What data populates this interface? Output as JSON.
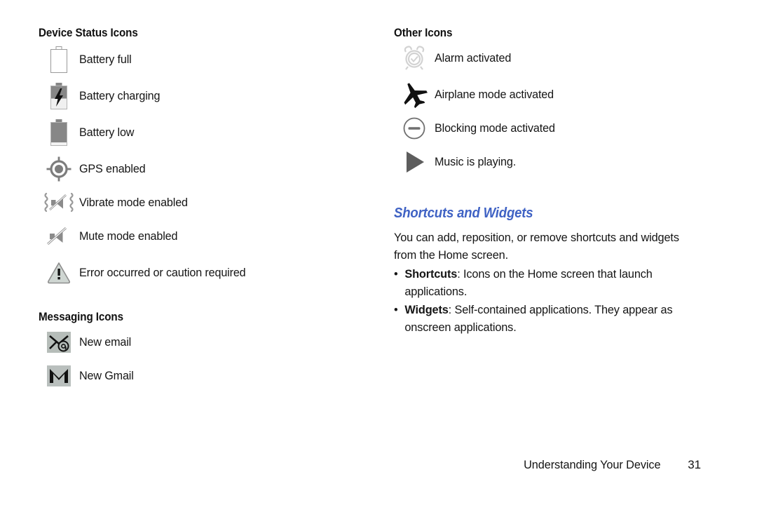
{
  "document": {
    "footer_title": "Understanding Your Device",
    "footer_page": "31"
  },
  "left_column": {
    "sections": [
      {
        "heading": "Device Status Icons",
        "rows": [
          {
            "icon": "battery-full-icon",
            "label": "Battery full"
          },
          {
            "icon": "battery-charging-icon",
            "label": "Battery charging"
          },
          {
            "icon": "battery-low-icon",
            "label": "Battery low"
          },
          {
            "icon": "gps-icon",
            "label": "GPS enabled"
          },
          {
            "icon": "vibrate-icon",
            "label": "Vibrate mode enabled"
          },
          {
            "icon": "mute-icon",
            "label": "Mute mode enabled"
          },
          {
            "icon": "warning-icon",
            "label": "Error occurred or caution required"
          }
        ]
      },
      {
        "heading": "Messaging Icons",
        "rows": [
          {
            "icon": "new-email-icon",
            "label": "New email"
          },
          {
            "icon": "new-gmail-icon",
            "label": "New Gmail"
          }
        ]
      }
    ]
  },
  "right_column": {
    "sections": [
      {
        "heading": "Other Icons",
        "rows": [
          {
            "icon": "alarm-icon",
            "label": "Alarm activated"
          },
          {
            "icon": "airplane-icon",
            "label": "Airplane mode activated"
          },
          {
            "icon": "blocking-mode-icon",
            "label": "Blocking mode activated"
          },
          {
            "icon": "play-icon",
            "label": "Music is playing."
          }
        ]
      }
    ],
    "article": {
      "heading": "Shortcuts and Widgets",
      "intro": "You can add, reposition, or remove shortcuts and widgets from the Home screen.",
      "bullets": [
        {
          "term": "Shortcuts",
          "text": ": Icons on the Home screen that launch applications."
        },
        {
          "term": "Widgets",
          "text": ": Self-contained applications. They appear as onscreen applications."
        }
      ]
    }
  },
  "colors": {
    "heading_blue": "#3f62c4",
    "body_text": "#151515",
    "icon_grey": "#7d7d7d",
    "icon_light_grey": "#c9c9c9",
    "tile_grey": "#b9c0bd"
  }
}
